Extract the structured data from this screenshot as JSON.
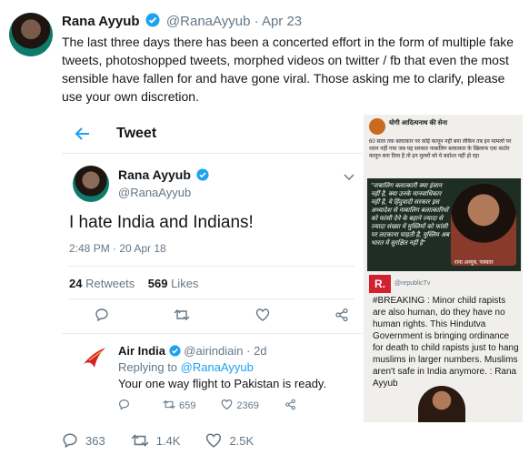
{
  "tweet": {
    "name": "Rana Ayyub",
    "handle": "@RanaAyyub",
    "separator": "·",
    "date": "Apr 23",
    "text": "The last three days there has been a concerted effort in the form of multiple fake tweets, photoshopped tweets, morphed videos on twitter / fb that even the most sensible have fallen for and have gone viral. Those asking me to clarify, please use your own discretion.",
    "replies": "363",
    "retweets": "1.4K",
    "likes": "2.5K"
  },
  "card": {
    "header": "Tweet",
    "name": "Rana Ayyub",
    "handle": "@RanaAyyub",
    "text": "I hate India and Indians!",
    "time": "2:48 PM · 20 Apr 18",
    "retweet_count": "24",
    "retweet_label": "Retweets",
    "like_count": "569",
    "like_label": "Likes",
    "reply": {
      "name": "Air India",
      "handle": "@airindiain",
      "date": "· 2d",
      "replying_prefix": "Replying to ",
      "replying_handle": "@RanaAyyub",
      "text": "Your one way flight to Pakistan is ready.",
      "retweets": "659",
      "likes": "2369"
    }
  },
  "photo": {
    "top_title": "योगी आदित्यनाथ की सेना",
    "top_text": "60 साल तक बलात्कार पर कोई कानून नहीं बना लेकिन तब इन मामलों पर ध्यान नहीं गया जब यह सरकार नाबालिग बलात्कार के खिलाफ एक कठोर कानून बना दिया है तो इन मुल्लों को ये बर्दाश्त नहीं हो रहा",
    "hindi_quote": "\"नाबालिग बलात्कारी क्या इंसान नहीं है, क्या उनके मानवाधिकार नहीं है, ये हिंदुवादी सरकार इस अध्यादेश से नाबालिग बलात्कारियों को फांसी देने के बहाने ज्यादा से ज्यादा संख्या में मुस्लिमों को फांसी पर लटकाना चाहती है, मुस्लिम अब भारत में सुरक्षित नहीं है\"",
    "caption": "राना अय्यूब, पत्रकार",
    "r_logo": "R.",
    "republic_handle": "@republicTv",
    "breaking": "#BREAKING : Minor child rapists are also human, do they have no human rights. This Hindutva Government is bringing ordinance for death to child rapists just to hang muslims in larger numbers. Muslims aren't safe in India anymore. : Rana Ayyub"
  }
}
